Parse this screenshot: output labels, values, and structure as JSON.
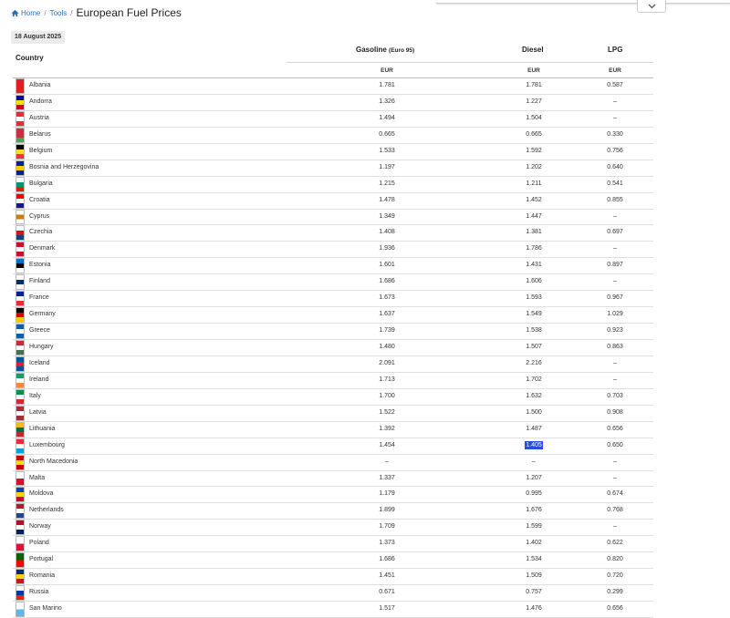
{
  "breadcrumb": {
    "home": "Home",
    "tools": "Tools",
    "title": "European Fuel Prices"
  },
  "date": "18 August 2025",
  "headers": {
    "country": "Country",
    "gasoline": "Gasoline",
    "gasoline_sub": "(Euro 95)",
    "diesel": "Diesel",
    "lpg": "LPG",
    "currency": "EUR"
  },
  "highlight": {
    "country": "Luxembourg",
    "column": "diesel"
  },
  "rows": [
    {
      "country": "Albania",
      "gasoline": "1.781",
      "diesel": "1.781",
      "lpg": "0.587",
      "flag": "albania-flag-icon",
      "colors": [
        "#e41e20"
      ]
    },
    {
      "country": "Andorra",
      "gasoline": "1.326",
      "diesel": "1.227",
      "lpg": "–",
      "flag": "andorra-flag-icon",
      "colors": [
        "#10069f",
        "#fedf00",
        "#d50032"
      ]
    },
    {
      "country": "Austria",
      "gasoline": "1.494",
      "diesel": "1.504",
      "lpg": "–",
      "flag": "austria-flag-icon",
      "colors": [
        "#ed2939",
        "#ffffff",
        "#ed2939"
      ]
    },
    {
      "country": "Belarus",
      "gasoline": "0.665",
      "diesel": "0.665",
      "lpg": "0.330",
      "flag": "belarus-flag-icon",
      "colors": [
        "#c8313e",
        "#c8313e",
        "#4aa657"
      ]
    },
    {
      "country": "Belgium",
      "gasoline": "1.533",
      "diesel": "1.592",
      "lpg": "0.756",
      "flag": "belgium-flag-icon",
      "colors": [
        "#000000",
        "#fdda24",
        "#ef3340"
      ]
    },
    {
      "country": "Bosnia and Herzegovina",
      "gasoline": "1.197",
      "diesel": "1.202",
      "lpg": "0.640",
      "flag": "bosnia-flag-icon",
      "colors": [
        "#002395",
        "#fecb00",
        "#002395"
      ]
    },
    {
      "country": "Bulgaria",
      "gasoline": "1.215",
      "diesel": "1.211",
      "lpg": "0.541",
      "flag": "bulgaria-flag-icon",
      "colors": [
        "#ffffff",
        "#00966e",
        "#d62612"
      ]
    },
    {
      "country": "Croatia",
      "gasoline": "1.478",
      "diesel": "1.452",
      "lpg": "0.855",
      "flag": "croatia-flag-icon",
      "colors": [
        "#ff0000",
        "#ffffff",
        "#171796"
      ]
    },
    {
      "country": "Cyprus",
      "gasoline": "1.349",
      "diesel": "1.447",
      "lpg": "–",
      "flag": "cyprus-flag-icon",
      "colors": [
        "#ffffff",
        "#d57800",
        "#ffffff"
      ]
    },
    {
      "country": "Czechia",
      "gasoline": "1.408",
      "diesel": "1.381",
      "lpg": "0.697",
      "flag": "czechia-flag-icon",
      "colors": [
        "#ffffff",
        "#d7141a",
        "#11457e"
      ]
    },
    {
      "country": "Denmark",
      "gasoline": "1.936",
      "diesel": "1.786",
      "lpg": "–",
      "flag": "denmark-flag-icon",
      "colors": [
        "#c8102e",
        "#ffffff",
        "#c8102e"
      ]
    },
    {
      "country": "Estonia",
      "gasoline": "1.601",
      "diesel": "1.431",
      "lpg": "0.897",
      "flag": "estonia-flag-icon",
      "colors": [
        "#0072ce",
        "#000000",
        "#ffffff"
      ]
    },
    {
      "country": "Finland",
      "gasoline": "1.686",
      "diesel": "1.606",
      "lpg": "–",
      "flag": "finland-flag-icon",
      "colors": [
        "#ffffff",
        "#002f6c",
        "#ffffff"
      ]
    },
    {
      "country": "France",
      "gasoline": "1.673",
      "diesel": "1.593",
      "lpg": "0.967",
      "flag": "france-flag-icon",
      "colors": [
        "#002395",
        "#ffffff",
        "#ed2939"
      ]
    },
    {
      "country": "Germany",
      "gasoline": "1.637",
      "diesel": "1.549",
      "lpg": "1.029",
      "flag": "germany-flag-icon",
      "colors": [
        "#000000",
        "#dd0000",
        "#ffce00"
      ]
    },
    {
      "country": "Greece",
      "gasoline": "1.739",
      "diesel": "1.538",
      "lpg": "0.923",
      "flag": "greece-flag-icon",
      "colors": [
        "#0d5eaf",
        "#ffffff",
        "#0d5eaf"
      ]
    },
    {
      "country": "Hungary",
      "gasoline": "1.480",
      "diesel": "1.507",
      "lpg": "0.863",
      "flag": "hungary-flag-icon",
      "colors": [
        "#ce2939",
        "#ffffff",
        "#477050"
      ]
    },
    {
      "country": "Iceland",
      "gasoline": "2.091",
      "diesel": "2.216",
      "lpg": "–",
      "flag": "iceland-flag-icon",
      "colors": [
        "#02529c",
        "#dc1e35",
        "#02529c"
      ]
    },
    {
      "country": "Ireland",
      "gasoline": "1.713",
      "diesel": "1.702",
      "lpg": "–",
      "flag": "ireland-flag-icon",
      "colors": [
        "#169b62",
        "#ffffff",
        "#ff883e"
      ]
    },
    {
      "country": "Italy",
      "gasoline": "1.700",
      "diesel": "1.632",
      "lpg": "0.703",
      "flag": "italy-flag-icon",
      "colors": [
        "#009246",
        "#ffffff",
        "#ce2b37"
      ]
    },
    {
      "country": "Latvia",
      "gasoline": "1.522",
      "diesel": "1.500",
      "lpg": "0.908",
      "flag": "latvia-flag-icon",
      "colors": [
        "#9e3039",
        "#ffffff",
        "#9e3039"
      ]
    },
    {
      "country": "Lithuania",
      "gasoline": "1.392",
      "diesel": "1.487",
      "lpg": "0.656",
      "flag": "lithuania-flag-icon",
      "colors": [
        "#fdb913",
        "#006a44",
        "#c1272d"
      ]
    },
    {
      "country": "Luxembourg",
      "gasoline": "1.454",
      "diesel": "1.405",
      "lpg": "0.650",
      "flag": "luxembourg-flag-icon",
      "colors": [
        "#ed2939",
        "#ffffff",
        "#00a1de"
      ]
    },
    {
      "country": "North Macedonia",
      "gasoline": "–",
      "diesel": "–",
      "lpg": "–",
      "flag": "north-macedonia-flag-icon",
      "colors": [
        "#d20000",
        "#ffe600",
        "#d20000"
      ]
    },
    {
      "country": "Malta",
      "gasoline": "1.337",
      "diesel": "1.207",
      "lpg": "–",
      "flag": "malta-flag-icon",
      "colors": [
        "#ffffff",
        "#cf142b"
      ]
    },
    {
      "country": "Moldova",
      "gasoline": "1.179",
      "diesel": "0.995",
      "lpg": "0.674",
      "flag": "moldova-flag-icon",
      "colors": [
        "#0046ae",
        "#ffd200",
        "#cc092f"
      ]
    },
    {
      "country": "Netherlands",
      "gasoline": "1.899",
      "diesel": "1.676",
      "lpg": "0.768",
      "flag": "netherlands-flag-icon",
      "colors": [
        "#ae1c28",
        "#ffffff",
        "#21468b"
      ]
    },
    {
      "country": "Norway",
      "gasoline": "1.709",
      "diesel": "1.599",
      "lpg": "–",
      "flag": "norway-flag-icon",
      "colors": [
        "#ba0c2f",
        "#ffffff",
        "#00205b"
      ]
    },
    {
      "country": "Poland",
      "gasoline": "1.373",
      "diesel": "1.402",
      "lpg": "0.622",
      "flag": "poland-flag-icon",
      "colors": [
        "#ffffff",
        "#dc143c"
      ]
    },
    {
      "country": "Portugal",
      "gasoline": "1.686",
      "diesel": "1.534",
      "lpg": "0.820",
      "flag": "portugal-flag-icon",
      "colors": [
        "#006600",
        "#ff0000"
      ]
    },
    {
      "country": "Romania",
      "gasoline": "1.451",
      "diesel": "1.509",
      "lpg": "0.720",
      "flag": "romania-flag-icon",
      "colors": [
        "#002b7f",
        "#fcd116",
        "#ce1126"
      ]
    },
    {
      "country": "Russia",
      "gasoline": "0.671",
      "diesel": "0.757",
      "lpg": "0.299",
      "flag": "russia-flag-icon",
      "colors": [
        "#ffffff",
        "#0039a6",
        "#d52b1e"
      ]
    },
    {
      "country": "San Marino",
      "gasoline": "1.517",
      "diesel": "1.476",
      "lpg": "0.656",
      "flag": "san-marino-flag-icon",
      "colors": [
        "#ffffff",
        "#5eb6e4"
      ]
    }
  ]
}
